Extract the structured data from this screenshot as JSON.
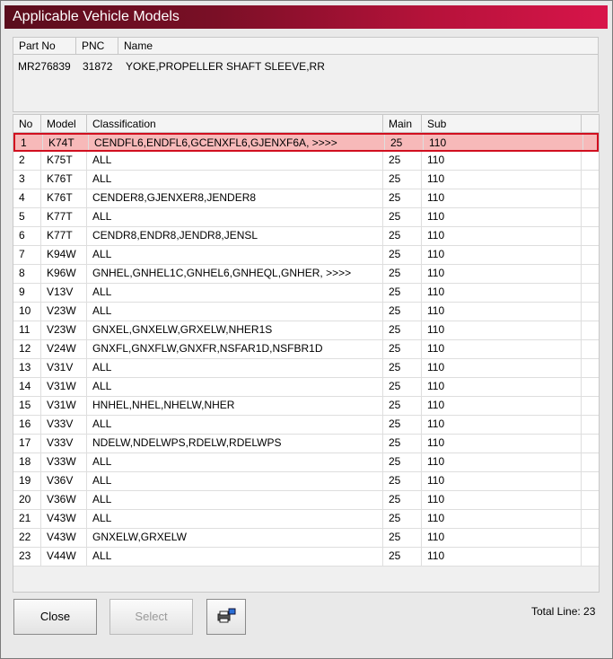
{
  "window": {
    "title": "Applicable Vehicle Models"
  },
  "part_info": {
    "headers": [
      "Part No",
      "PNC",
      "Name"
    ],
    "part_no": "MR276839",
    "pnc": "31872",
    "name": "YOKE,PROPELLER SHAFT SLEEVE,RR"
  },
  "table": {
    "headers": {
      "no": "No",
      "model": "Model",
      "classification": "Classification",
      "main": "Main",
      "sub": "Sub"
    },
    "selected_index": 0,
    "rows": [
      {
        "no": "1",
        "model": "K74T",
        "classification": "CENDFL6,ENDFL6,GCENXFL6,GJENXF6A,  >>>>",
        "main": "25",
        "sub": "110"
      },
      {
        "no": "2",
        "model": "K75T",
        "classification": "ALL",
        "main": "25",
        "sub": "110"
      },
      {
        "no": "3",
        "model": "K76T",
        "classification": "ALL",
        "main": "25",
        "sub": "110"
      },
      {
        "no": "4",
        "model": "K76T",
        "classification": "CENDER8,GJENXER8,JENDER8",
        "main": "25",
        "sub": "110"
      },
      {
        "no": "5",
        "model": "K77T",
        "classification": "ALL",
        "main": "25",
        "sub": "110"
      },
      {
        "no": "6",
        "model": "K77T",
        "classification": "CENDR8,ENDR8,JENDR8,JENSL",
        "main": "25",
        "sub": "110"
      },
      {
        "no": "7",
        "model": "K94W",
        "classification": "ALL",
        "main": "25",
        "sub": "110"
      },
      {
        "no": "8",
        "model": "K96W",
        "classification": "GNHEL,GNHEL1C,GNHEL6,GNHEQL,GNHER,  >>>>",
        "main": "25",
        "sub": "110"
      },
      {
        "no": "9",
        "model": "V13V",
        "classification": "ALL",
        "main": "25",
        "sub": "110"
      },
      {
        "no": "10",
        "model": "V23W",
        "classification": "ALL",
        "main": "25",
        "sub": "110"
      },
      {
        "no": "11",
        "model": "V23W",
        "classification": "GNXEL,GNXELW,GRXELW,NHER1S",
        "main": "25",
        "sub": "110"
      },
      {
        "no": "12",
        "model": "V24W",
        "classification": "GNXFL,GNXFLW,GNXFR,NSFAR1D,NSFBR1D",
        "main": "25",
        "sub": "110"
      },
      {
        "no": "13",
        "model": "V31V",
        "classification": "ALL",
        "main": "25",
        "sub": "110"
      },
      {
        "no": "14",
        "model": "V31W",
        "classification": "ALL",
        "main": "25",
        "sub": "110"
      },
      {
        "no": "15",
        "model": "V31W",
        "classification": "HNHEL,NHEL,NHELW,NHER",
        "main": "25",
        "sub": "110"
      },
      {
        "no": "16",
        "model": "V33V",
        "classification": "ALL",
        "main": "25",
        "sub": "110"
      },
      {
        "no": "17",
        "model": "V33V",
        "classification": "NDELW,NDELWPS,RDELW,RDELWPS",
        "main": "25",
        "sub": "110"
      },
      {
        "no": "18",
        "model": "V33W",
        "classification": "ALL",
        "main": "25",
        "sub": "110"
      },
      {
        "no": "19",
        "model": "V36V",
        "classification": "ALL",
        "main": "25",
        "sub": "110"
      },
      {
        "no": "20",
        "model": "V36W",
        "classification": "ALL",
        "main": "25",
        "sub": "110"
      },
      {
        "no": "21",
        "model": "V43W",
        "classification": "ALL",
        "main": "25",
        "sub": "110"
      },
      {
        "no": "22",
        "model": "V43W",
        "classification": "GNXELW,GRXELW",
        "main": "25",
        "sub": "110"
      },
      {
        "no": "23",
        "model": "V44W",
        "classification": "ALL",
        "main": "25",
        "sub": "110"
      }
    ]
  },
  "buttons": {
    "close": "Close",
    "select": "Select",
    "print_icon": "printer-icon"
  },
  "footer": {
    "total_lines": "Total Line: 23"
  },
  "colors": {
    "title_start": "#5a0d1c",
    "title_end": "#d8154a",
    "selected_bg": "#f7b9b9",
    "selected_border": "#d10f1f"
  }
}
